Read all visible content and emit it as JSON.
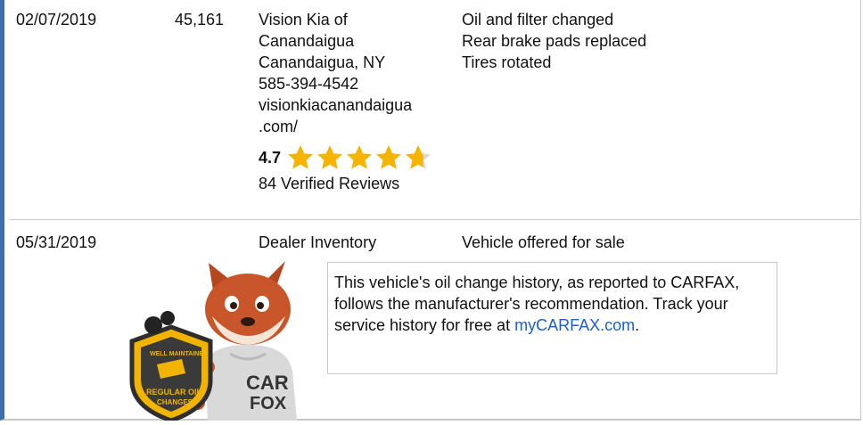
{
  "records": [
    {
      "date": "02/07/2019",
      "odometer": "45,161",
      "source": {
        "lines": [
          "Vision Kia of",
          "Canandaigua",
          "Canandaigua, NY",
          "585-394-4542",
          "visionkiacanandaigua",
          ".com/"
        ],
        "rating": "4.7",
        "rating_fraction": 0.94,
        "reviews": "84 Verified Reviews"
      },
      "details": [
        "Oil and filter changed",
        "Rear brake pads replaced",
        "Tires rotated"
      ]
    },
    {
      "date": "05/31/2019",
      "source": {
        "lines": [
          "Dealer Inventory"
        ]
      },
      "details": [
        "Vehicle offered for sale"
      ]
    }
  ],
  "callout": {
    "text": "This vehicle's oil change history, as reported to CARFAX, follows the manufacturer's recommendation. Track your service history for free at ",
    "link": "myCARFAX.com",
    "link_suffix": "."
  },
  "badge": {
    "line1": "WELL MAINTAINED",
    "line2": "REGULAR OIL",
    "line3": "CHANGES",
    "shirt_line1": "CAR",
    "shirt_line2": "FOX"
  },
  "colors": {
    "accent_border": "#3e6fa8",
    "star": "#f5b400",
    "star_empty": "#d9d9d9",
    "link": "#1a5fd0"
  }
}
